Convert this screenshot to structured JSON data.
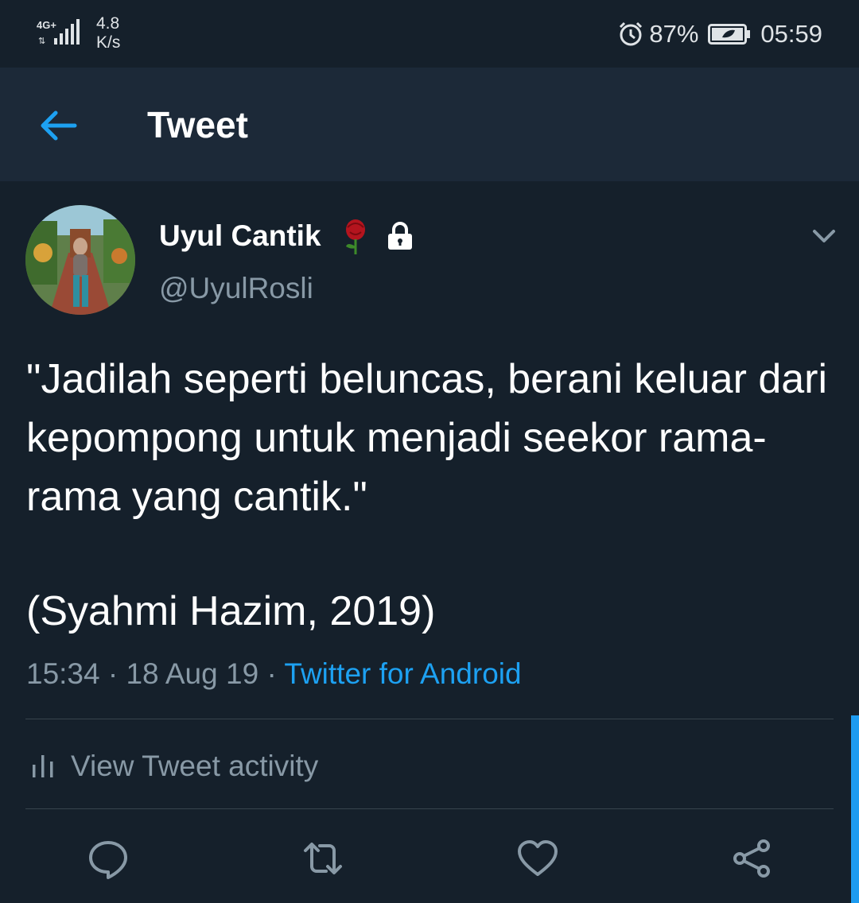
{
  "status_bar": {
    "network": "4G+",
    "speed_value": "4.8",
    "speed_unit": "K/s",
    "battery": "87%",
    "time": "05:59"
  },
  "header": {
    "title": "Tweet",
    "back_icon": "arrow-left-icon"
  },
  "tweet": {
    "author_name": "Uyul Cantik",
    "author_handle": "@UyulRosli",
    "emoji_icon": "rose-icon",
    "lock_icon": "lock-icon",
    "text": "\"Jadilah seperti beluncas, berani keluar dari kepompong untuk menjadi seekor rama-rama yang cantik.\"",
    "citation": "(Syahmi Hazim, 2019)",
    "time": "15:34",
    "date": "18 Aug 19",
    "separator": "·",
    "source": "Twitter for Android"
  },
  "activity": {
    "label": "View Tweet activity",
    "icon": "bar-chart-icon"
  },
  "actions": [
    {
      "name": "reply",
      "icon": "reply-icon"
    },
    {
      "name": "retweet",
      "icon": "retweet-icon"
    },
    {
      "name": "like",
      "icon": "heart-icon"
    },
    {
      "name": "share",
      "icon": "share-icon"
    }
  ],
  "colors": {
    "background": "#15202b",
    "header": "#1c2938",
    "accent": "#1da1f2",
    "secondary_text": "#8899a6",
    "divider": "#38444d"
  }
}
